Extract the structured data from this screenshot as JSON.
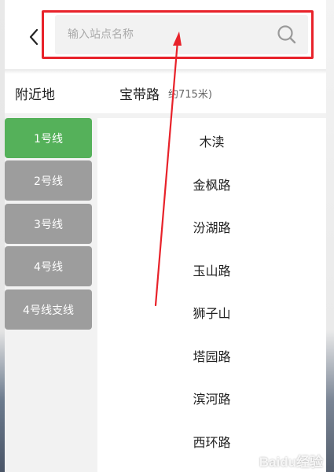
{
  "search": {
    "placeholder": "输入站点名称"
  },
  "nearby": {
    "title": "附近地",
    "station": "宝带路",
    "distance": "约715米)"
  },
  "lines": [
    {
      "label": "1号线",
      "active": true
    },
    {
      "label": "2号线",
      "active": false
    },
    {
      "label": "3号线",
      "active": false
    },
    {
      "label": "4号线",
      "active": false
    },
    {
      "label": "4号线支线",
      "active": false
    }
  ],
  "stations": [
    "木渎",
    "金枫路",
    "汾湖路",
    "玉山路",
    "狮子山",
    "塔园路",
    "滨河路",
    "西环路"
  ],
  "colors": {
    "active_line": "#55b15a",
    "inactive_line": "#9d9d9d",
    "highlight": "#e8222a"
  },
  "icons": {
    "back": "chevron-left-icon",
    "search": "search-icon"
  },
  "watermark": {
    "text": "Baidu经验"
  }
}
